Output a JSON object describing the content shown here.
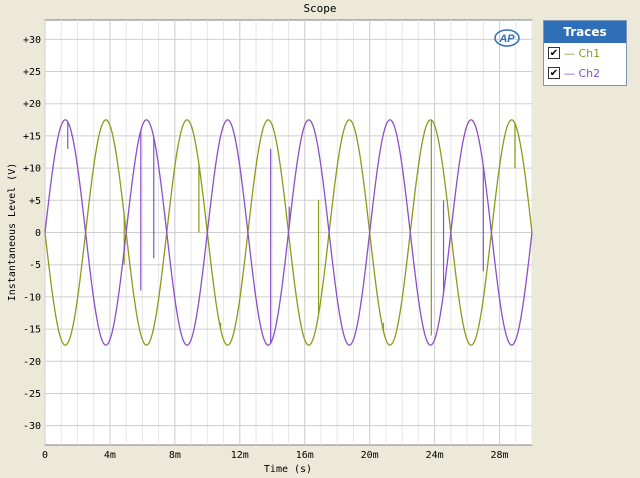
{
  "window": {
    "title": "Scope"
  },
  "traces_panel": {
    "header": "Traces",
    "items": [
      {
        "label": "— Ch1",
        "checked": true,
        "color": "#8c9a1a"
      },
      {
        "label": "— Ch2",
        "checked": true,
        "color": "#8b4fc7"
      }
    ]
  },
  "logo": {
    "text": "AP",
    "icon": "ap-logo-icon"
  },
  "chart_data": {
    "type": "line",
    "xlabel": "Time (s)",
    "ylabel": "Instantaneous Level (V)",
    "xlim": [
      0,
      0.03
    ],
    "ylim": [
      -33,
      33
    ],
    "x_ticks": [
      0,
      0.004,
      0.008,
      0.012,
      0.016,
      0.02,
      0.024,
      0.028
    ],
    "x_tick_labels": [
      "0",
      "4m",
      "8m",
      "12m",
      "16m",
      "20m",
      "24m",
      "28m"
    ],
    "y_ticks": [
      30,
      25,
      20,
      15,
      10,
      5,
      0,
      -5,
      -10,
      -15,
      -20,
      -25,
      -30
    ],
    "y_tick_labels": [
      "+30",
      "+25",
      "+20",
      "+15",
      "+10",
      "+5",
      "0",
      "-5",
      "-10",
      "-15",
      "-20",
      "-25",
      "-30"
    ],
    "grid": true,
    "series": [
      {
        "name": "Ch1",
        "color": "#8c9a1a",
        "amplitude": 17.5,
        "frequency_hz": 200,
        "phase_sign": -1,
        "spikes": [
          {
            "x": 0.00488,
            "y": -5
          },
          {
            "x": 0.00948,
            "y": 0
          },
          {
            "x": 0.01082,
            "y": -14
          },
          {
            "x": 0.01685,
            "y": 5
          },
          {
            "x": 0.02085,
            "y": -14
          },
          {
            "x": 0.0238,
            "y": -16
          },
          {
            "x": 0.02895,
            "y": 10
          }
        ]
      },
      {
        "name": "Ch2",
        "color": "#8b4fc7",
        "amplitude": 17.5,
        "frequency_hz": 200,
        "phase_sign": 1,
        "spikes": [
          {
            "x": 0.0014,
            "y": 13
          },
          {
            "x": 0.00165,
            "y": 15
          },
          {
            "x": 0.0059,
            "y": -9
          },
          {
            "x": 0.0067,
            "y": -4
          },
          {
            "x": 0.0139,
            "y": 13
          },
          {
            "x": 0.01505,
            "y": 4
          },
          {
            "x": 0.02455,
            "y": 5
          },
          {
            "x": 0.027,
            "y": -6
          }
        ]
      }
    ]
  }
}
